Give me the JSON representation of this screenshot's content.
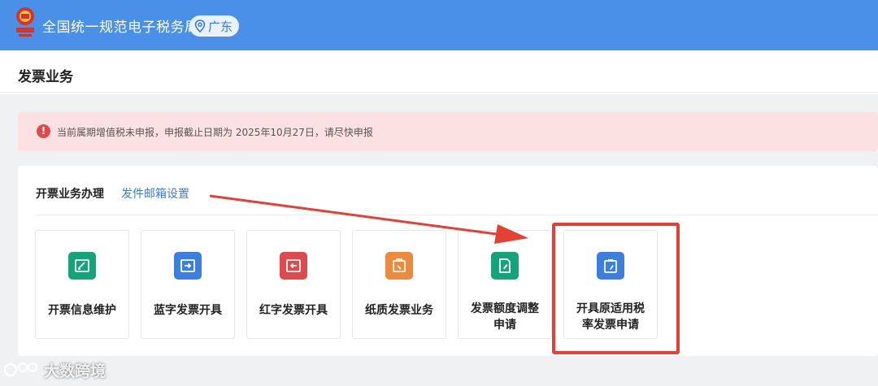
{
  "header": {
    "title": "全国统一规范电子税务局",
    "region": "广东"
  },
  "page": {
    "title": "发票业务"
  },
  "alert": {
    "text": "当前属期增值税未申报，申报截止日期为 2025年10月27日，请尽快申报"
  },
  "panel": {
    "heading": "开票业务办理",
    "link_label": "发件邮箱设置",
    "cards": [
      {
        "label": "开票信息维护",
        "icon": "edit-card-icon",
        "color": "#15a37a"
      },
      {
        "label": "蓝字发票开具",
        "icon": "blue-invoice-icon",
        "color": "#3d7fe0"
      },
      {
        "label": "红字发票开具",
        "icon": "red-invoice-icon",
        "color": "#e04a4f"
      },
      {
        "label": "纸质发票业务",
        "icon": "paper-invoice-icon",
        "color": "#ef8a3c"
      },
      {
        "label_line1": "发票额度调整",
        "label_line2": "申请",
        "icon": "quota-adjust-icon",
        "color": "#15a37a"
      },
      {
        "label_line1": "开具原适用税",
        "label_line2": "率发票申请",
        "icon": "original-rate-icon",
        "color": "#3d7fe0"
      }
    ]
  },
  "watermark": {
    "text": "大数跨境"
  },
  "colors": {
    "topbar": "#4a90e8",
    "alert_bg": "#fbe1e2",
    "highlight": "#e64036",
    "link": "#3b7be0"
  }
}
